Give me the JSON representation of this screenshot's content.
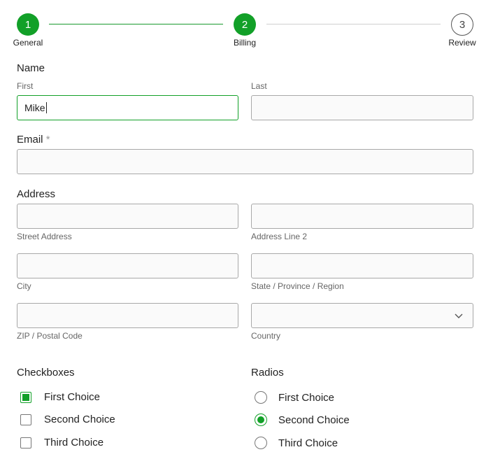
{
  "stepper": {
    "steps": [
      {
        "number": "1",
        "label": "General"
      },
      {
        "number": "2",
        "label": "Billing"
      },
      {
        "number": "3",
        "label": "Review"
      }
    ]
  },
  "name": {
    "label": "Name",
    "first_label": "First",
    "first_value": "Mike",
    "last_label": "Last",
    "last_value": ""
  },
  "email": {
    "label": "Email",
    "required_mark": "*",
    "value": ""
  },
  "address": {
    "label": "Address",
    "street_label": "Street Address",
    "line2_label": "Address Line 2",
    "city_label": "City",
    "state_label": "State / Province / Region",
    "zip_label": "ZIP / Postal Code",
    "country_label": "Country",
    "country_value": ""
  },
  "checkboxes": {
    "label": "Checkboxes",
    "options": [
      {
        "label": "First Choice",
        "checked": true
      },
      {
        "label": "Second Choice",
        "checked": false
      },
      {
        "label": "Third Choice",
        "checked": false
      }
    ]
  },
  "radios": {
    "label": "Radios",
    "options": [
      {
        "label": "First Choice",
        "checked": false
      },
      {
        "label": "Second Choice",
        "checked": true
      },
      {
        "label": "Third Choice",
        "checked": false
      }
    ]
  },
  "colors": {
    "accent": "#12a028",
    "border": "#a8a8a8"
  },
  "icons": {
    "country_dropdown": "chevron-down-icon"
  }
}
